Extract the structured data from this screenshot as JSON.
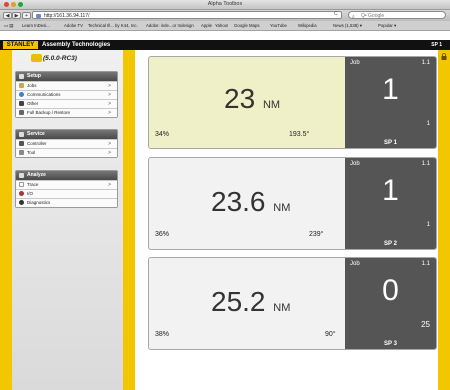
{
  "window": {
    "title": "Alpha Toolbox"
  },
  "toolbar": {
    "back_glyph": "◀",
    "forward_glyph": "▶",
    "add_glyph": "+",
    "url": "http://161.36.94.117/",
    "reload_glyph": "C",
    "search_placeholder": "Q• Google",
    "search_glyph": "⌕"
  },
  "bookmarks": [
    "Learn InDesi...",
    "Adobe TV",
    "Technical Ill... by K44, Inc.",
    "Adobe: inde...or Indesign",
    "Apple",
    "Yahoo!",
    "Google Maps",
    "YouTube",
    "Wikipedia",
    "News (1,538) ▾",
    "Popular ▾"
  ],
  "header": {
    "brand": "STANLEY",
    "subtitle": "Assembly Technologies",
    "right_label": "SP 1"
  },
  "sidebar": {
    "version": "(5.0.0-RC3)",
    "panels": [
      {
        "title": "Setup",
        "items": [
          {
            "label": "Jobs",
            "chevron": ">"
          },
          {
            "label": "Communications",
            "chevron": ">"
          },
          {
            "label": "Other",
            "chevron": ">"
          },
          {
            "label": "Full Backup / Restore",
            "chevron": ">"
          }
        ]
      },
      {
        "title": "Service",
        "items": [
          {
            "label": "Controller",
            "chevron": ">"
          },
          {
            "label": "Tool",
            "chevron": ">"
          }
        ]
      },
      {
        "title": "Analyze",
        "items": [
          {
            "label": "Trace",
            "chevron": ">"
          },
          {
            "label": "I/O",
            "chevron": ""
          },
          {
            "label": "Diagnostics",
            "chevron": ""
          }
        ]
      }
    ]
  },
  "spindles": [
    {
      "torque": "23",
      "unit": "NM",
      "percent": "34%",
      "angle": "193.5°",
      "job_label": "Job",
      "job_version": "1.1",
      "job_number": "1",
      "sub_count": "1",
      "sp_label": "SP 1",
      "active": true
    },
    {
      "torque": "23.6",
      "unit": "NM",
      "percent": "36%",
      "angle": "239°",
      "job_label": "Job",
      "job_version": "1.1",
      "job_number": "1",
      "sub_count": "1",
      "sp_label": "SP 2",
      "active": false
    },
    {
      "torque": "25.2",
      "unit": "NM",
      "percent": "38%",
      "angle": "90°",
      "job_label": "Job",
      "job_version": "1.1",
      "job_number": "0",
      "sub_count": "25",
      "sp_label": "SP 3",
      "active": false
    }
  ],
  "colors": {
    "accent_yellow": "#f2c700",
    "active_card": "#efefc8",
    "job_box": "#555555"
  }
}
